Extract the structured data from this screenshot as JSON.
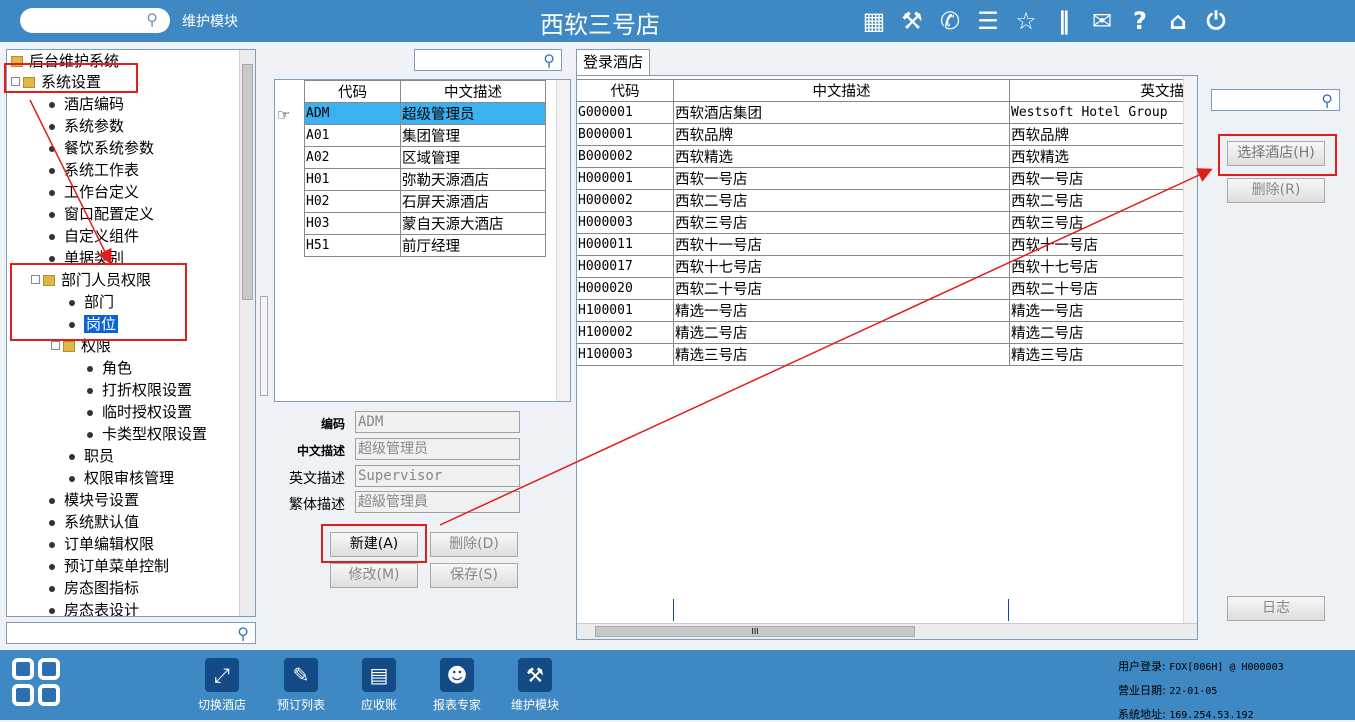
{
  "header": {
    "module_label": "维护模块",
    "title": "西软三号店"
  },
  "header_icons": [
    "signal-icon",
    "tools-icon",
    "phone-icon",
    "menu-icon",
    "star-icon",
    "columns-icon",
    "mail-icon",
    "help-icon",
    "home-icon",
    "power-icon"
  ],
  "tree": {
    "root": "后台维护系统",
    "system": "系统设置",
    "items": [
      "酒店编码",
      "系统参数",
      "餐饮系统参数",
      "系统工作表",
      "工作台定义",
      "窗口配置定义",
      "自定义组件",
      "单据类别"
    ],
    "dept": "部门人员权限",
    "dept_items": [
      "部门",
      "岗位"
    ],
    "perm": "权限",
    "perm_items": [
      "角色",
      "打折权限设置",
      "临时授权设置",
      "卡类型权限设置"
    ],
    "after": [
      "职员",
      "权限审核管理"
    ],
    "more": [
      "模块号设置",
      "系统默认值",
      "订单编辑权限",
      "预订单菜单控制",
      "房态图指标",
      "房态表设计"
    ]
  },
  "roles_table": {
    "headers": [
      "代码",
      "中文描述"
    ],
    "rows": [
      [
        "ADM",
        "超级管理员"
      ],
      [
        "A01",
        "集团管理"
      ],
      [
        "A02",
        "区域管理"
      ],
      [
        "H01",
        "弥勒天源酒店"
      ],
      [
        "H02",
        "石屏天源酒店"
      ],
      [
        "H03",
        "蒙自天源大酒店"
      ],
      [
        "H51",
        "前厅经理"
      ]
    ]
  },
  "form": {
    "code_label": "编码",
    "code_value": "ADM",
    "cn_label": "中文描述",
    "cn_value": "超级管理员",
    "en_label": "英文描述",
    "en_value": "Supervisor",
    "tw_label": "繁体描述",
    "tw_value": "超級管理員",
    "new_btn": "新建(A)",
    "del_btn": "删除(D)",
    "edit_btn": "修改(M)",
    "save_btn": "保存(S)"
  },
  "hotel_tab": "登录酒店",
  "hotel_table": {
    "headers": [
      "代码",
      "中文描述",
      "英文描"
    ],
    "rows": [
      [
        "G000001",
        "西软酒店集团",
        "Westsoft Hotel Group"
      ],
      [
        "B000001",
        "西软品牌",
        "西软品牌"
      ],
      [
        "B000002",
        "西软精选",
        "西软精选"
      ],
      [
        "H000001",
        "西软一号店",
        "西软一号店"
      ],
      [
        "H000002",
        "西软二号店",
        "西软二号店"
      ],
      [
        "H000003",
        "西软三号店",
        "西软三号店"
      ],
      [
        "H000011",
        "西软十一号店",
        "西软十一号店"
      ],
      [
        "H000017",
        "西软十七号店",
        "西软十七号店"
      ],
      [
        "H000020",
        "西软二十号店",
        "西软二十号店"
      ],
      [
        "H100001",
        "精选一号店",
        "精选一号店"
      ],
      [
        "H100002",
        "精选二号店",
        "精选二号店"
      ],
      [
        "H100003",
        "精选三号店",
        "精选三号店"
      ]
    ]
  },
  "right": {
    "select_btn": "选择酒店(H)",
    "delete_btn": "删除(R)",
    "log_btn": "日志"
  },
  "hscroll_mark": "III",
  "footer": {
    "buttons": [
      "切换酒店",
      "预订列表",
      "应收账",
      "报表专家",
      "维护模块"
    ],
    "user_label": "用户登录:",
    "user_value": "FOX[006H] @ H000003",
    "date_label": "营业日期:",
    "date_value": "22-01-05",
    "addr_label": "系统地址:",
    "addr_value": "169.254.53.192"
  }
}
